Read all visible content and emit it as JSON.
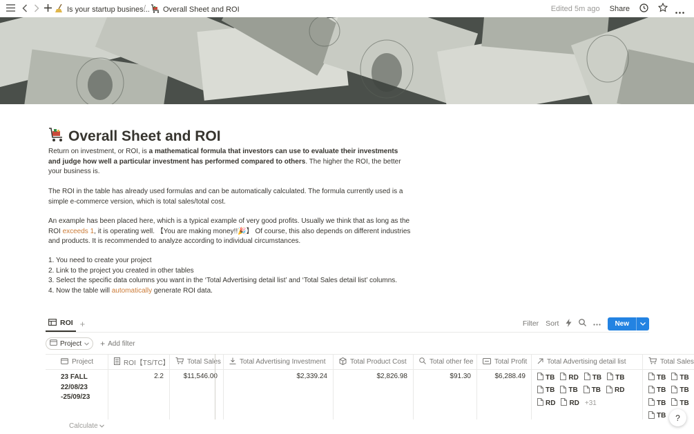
{
  "topbar": {
    "parent_crumb": "Is your startup busines...",
    "separator": "/",
    "current_crumb": "Overall Sheet and ROI",
    "edited": "Edited 5m ago",
    "share": "Share"
  },
  "page": {
    "title": "Overall Sheet and ROI",
    "p1": {
      "a": "Return on investment, or ROI, is ",
      "b": "a mathematical formula that investors can use to evaluate their investments and judge how well a particular investment has performed compared to others",
      "c": ". The higher the ROI, the better your business is."
    },
    "p2": "The ROI in the table has already used formulas and can be automatically calculated. The formula currently used is a simple e-commerce version, which is total sales/total cost.",
    "p3": {
      "a": "An example has been placed here, which is a typical example of very good profits. Usually we think that as long as the ROI ",
      "b": "exceeds 1",
      "c": ", it is operating well. 【You are making money!!🎉】 Of course, this also depends on different industries and products. It is recommended to analyze according to individual circumstances."
    },
    "steps": {
      "s1": "1. You need to create your project",
      "s2": "2. Link to the project you created in other tables",
      "s3": "3. Select the specific data columns you want in the ‘Total Advertising detail list’ and ‘Total Sales detail list’ columns.",
      "s4a": "4. Now the table will ",
      "s4b": "automatically",
      "s4c": " generate ROI data."
    }
  },
  "database": {
    "view_tab": "ROI",
    "filter": "Filter",
    "sort": "Sort",
    "new_button": "New",
    "project_chip": "Project",
    "add_filter": "Add filter",
    "columns": {
      "project": "Project",
      "roi": "ROI【TS/TC】",
      "total_sales": "Total Sales",
      "total_adv": "Total Advertising Investment",
      "total_prod": "Total Product Cost",
      "total_other": "Total other fee",
      "total_profit": "Total Profit",
      "adv_detail": "Total Advertising detail list",
      "sales_detail": "Total Sales detail list"
    },
    "row": {
      "project_l1": "23 FALL",
      "project_l2": "22/08/23",
      "project_l3": "-25/09/23",
      "roi": "2.2",
      "total_sales": "$11,546.00",
      "total_adv": "$2,339.24",
      "total_prod": "$2,826.98",
      "total_other": "$91.30",
      "total_profit": "$6,288.49",
      "adv_items": [
        "TB",
        "RD",
        "TB",
        "TB",
        "TB",
        "TB",
        "TB",
        "RD",
        "RD",
        "RD"
      ],
      "adv_more": "+31",
      "sales_items": [
        "TB",
        "TB",
        "TB",
        "TB",
        "TB",
        "TB",
        "TB"
      ]
    },
    "calculate": "Calculate"
  },
  "help": "?",
  "colors": {
    "accent": "#2383e2",
    "orange_text": "#cb7b37",
    "text": "#37352f",
    "muted": "#9b9a97"
  }
}
